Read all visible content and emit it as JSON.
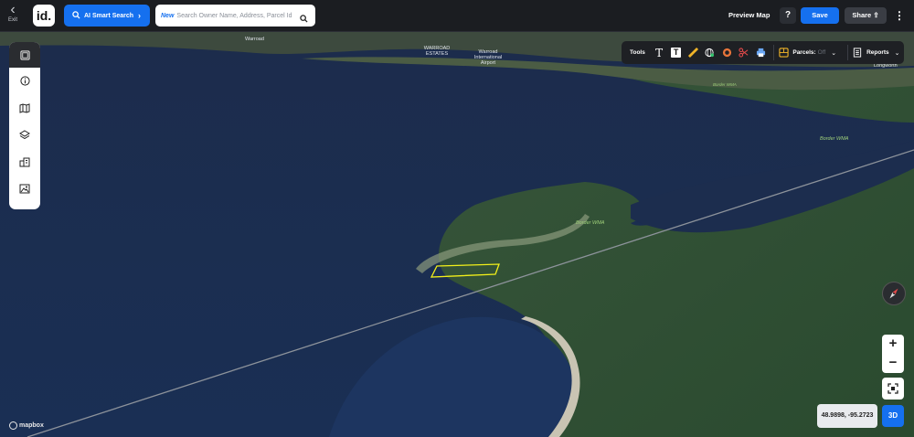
{
  "topbar": {
    "exit_label": "Exit",
    "logo_text": "id.",
    "ai_search_label": "AI Smart Search",
    "search_new_tag": "New",
    "search_placeholder": "Search Owner Name, Address, Parcel Id",
    "preview_label": "Preview Map",
    "help_label": "?",
    "save_label": "Save",
    "share_label": "Share"
  },
  "sidebar": {
    "items": [
      {
        "icon": "layout-icon"
      },
      {
        "icon": "info-icon"
      },
      {
        "icon": "map-icon"
      },
      {
        "icon": "layers-icon"
      },
      {
        "icon": "buildings-icon"
      },
      {
        "icon": "image-icon"
      }
    ]
  },
  "toolbar": {
    "tools_label": "Tools",
    "tool_icons": [
      "text-icon",
      "text-box-icon",
      "ruler-icon",
      "globe-pin-icon",
      "radius-icon",
      "scissors-icon",
      "print-icon"
    ],
    "parcels_label": "Parcels:",
    "parcels_value": "Off",
    "reports_label": "Reports"
  },
  "map_labels": {
    "warroad": "Warroad",
    "warroad_estates": "WARROAD ESTATES",
    "airport": "Warroad International Airport",
    "longworth": "Longworth",
    "border_wma_1": "Border WMA",
    "border_wma_2": "Border WMA",
    "border_wma_small": "Border WMA"
  },
  "map_controls": {
    "zoom_in": "+",
    "zoom_out": "−",
    "coordinates": "48.9898, -95.2723",
    "mode_3d": "3D",
    "attribution": "mapbox"
  },
  "colors": {
    "accent": "#1570ef",
    "water": "#1b2d4f",
    "forest": "#2c4a2c",
    "parcel_outline": "#f2ef1a"
  }
}
